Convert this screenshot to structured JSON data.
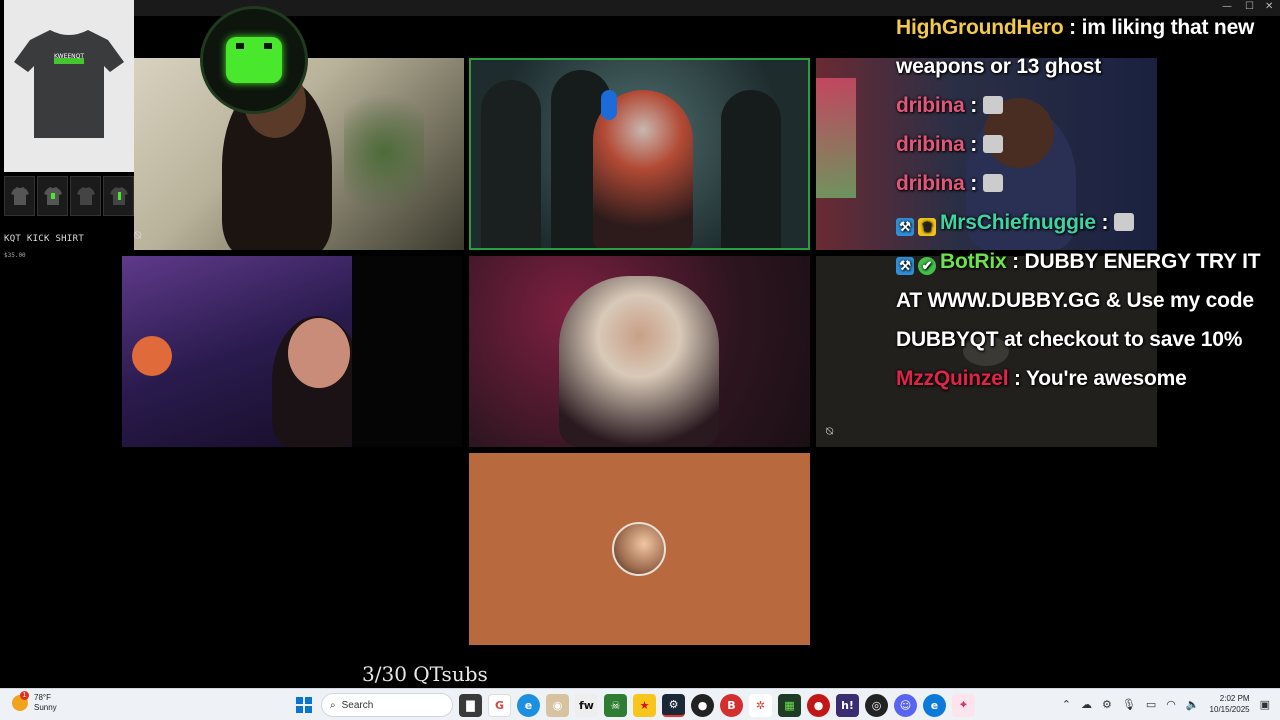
{
  "window": {
    "controls": [
      "—",
      "☐",
      "✕"
    ]
  },
  "shop": {
    "shirt_brand": "KWEENQT",
    "product_title": "KQT KICK SHIRT",
    "price": "$35.00"
  },
  "chat": {
    "messages": [
      {
        "user": "HighGroundHero",
        "color": "#f3c94b",
        "text": "im liking that new weapons or 13 ghost"
      },
      {
        "user": "dribina",
        "color": "#e2567a",
        "text": "",
        "emote": true
      },
      {
        "user": "dribina",
        "color": "#e2567a",
        "text": "",
        "emote": true
      },
      {
        "user": "dribina",
        "color": "#e2567a",
        "text": "",
        "emote": true
      },
      {
        "user": "MrsChiefnuggie",
        "color": "#3ed3a3",
        "text": "",
        "emote": true
      },
      {
        "user": "BotRix",
        "color": "#6de24a",
        "text": "DUBBY ENERGY TRY IT AT WWW.DUBBY.GG & Use my code DUBBYQT at checkout to save 10%"
      },
      {
        "user": "MzzQuinzel",
        "color": "#e02348",
        "text": "You're awesome"
      }
    ]
  },
  "overlay": {
    "sub_counter": "3/30 QTsubs"
  },
  "taskbar": {
    "weather_temp": "78°F",
    "weather_cond": "Sunny",
    "weather_alert": "1",
    "search_placeholder": "Search",
    "time": "2:02 PM",
    "date": "10/15/2025",
    "apps": [
      "files",
      "chrome",
      "edge",
      "game",
      "fw",
      "xbox",
      "star",
      "steam",
      "github",
      "brave",
      "mesh",
      "calc",
      "red",
      "hype",
      "obs",
      "discord",
      "edge2",
      "location"
    ]
  },
  "colors": {
    "accent_green": "#49e82c",
    "highlight_border": "#2b9e3e",
    "taskbar_bg": "#eef1f6"
  }
}
